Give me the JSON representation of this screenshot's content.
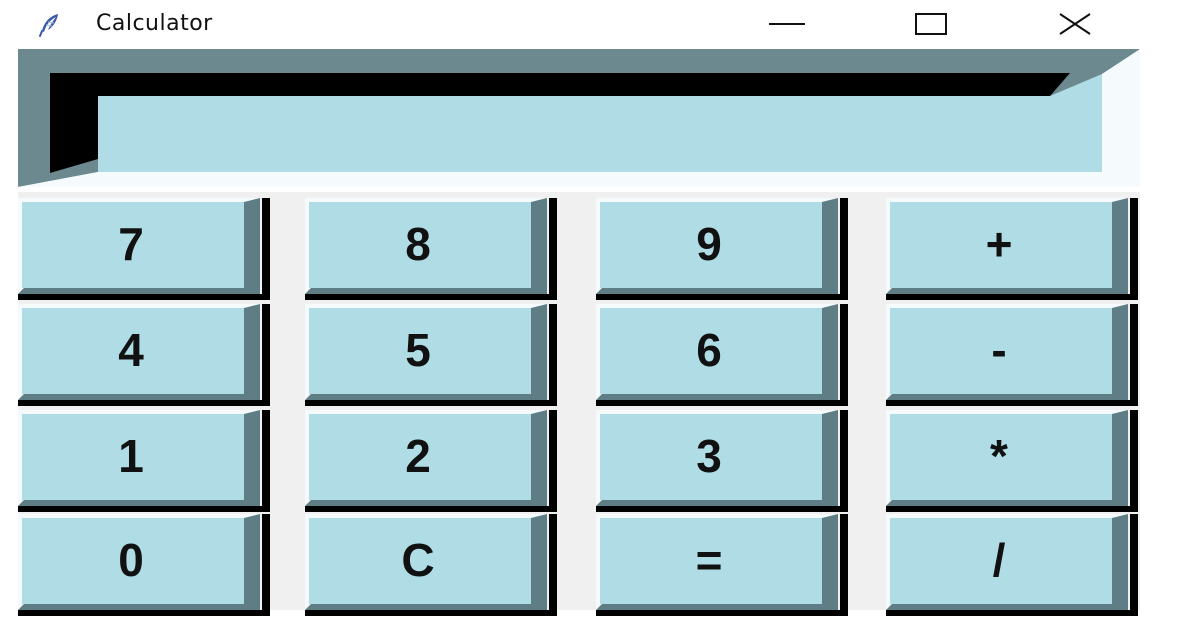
{
  "window": {
    "title": "Calculator",
    "icon": "feather-icon",
    "controls": {
      "minimize_icon": "minimize-icon",
      "maximize_icon": "maximize-icon",
      "close_icon": "close-icon"
    }
  },
  "display": {
    "value": ""
  },
  "colors": {
    "key_face": "#b0dde5",
    "key_shadow": "#000000",
    "key_bevel": "#5f7d85",
    "key_highlight": "#f5fbfc",
    "display_face": "#b0dde5",
    "display_bevel": "#6c8990",
    "keypad_bg": "#f0f0f0"
  },
  "keys": [
    {
      "label": "7",
      "name": "key-7"
    },
    {
      "label": "8",
      "name": "key-8"
    },
    {
      "label": "9",
      "name": "key-9"
    },
    {
      "label": "+",
      "name": "key-plus"
    },
    {
      "label": "4",
      "name": "key-4"
    },
    {
      "label": "5",
      "name": "key-5"
    },
    {
      "label": "6",
      "name": "key-6"
    },
    {
      "label": "-",
      "name": "key-minus"
    },
    {
      "label": "1",
      "name": "key-1"
    },
    {
      "label": "2",
      "name": "key-2"
    },
    {
      "label": "3",
      "name": "key-3"
    },
    {
      "label": "*",
      "name": "key-multiply"
    },
    {
      "label": "0",
      "name": "key-0"
    },
    {
      "label": "C",
      "name": "key-clear"
    },
    {
      "label": "=",
      "name": "key-equals"
    },
    {
      "label": "/",
      "name": "key-divide"
    }
  ]
}
